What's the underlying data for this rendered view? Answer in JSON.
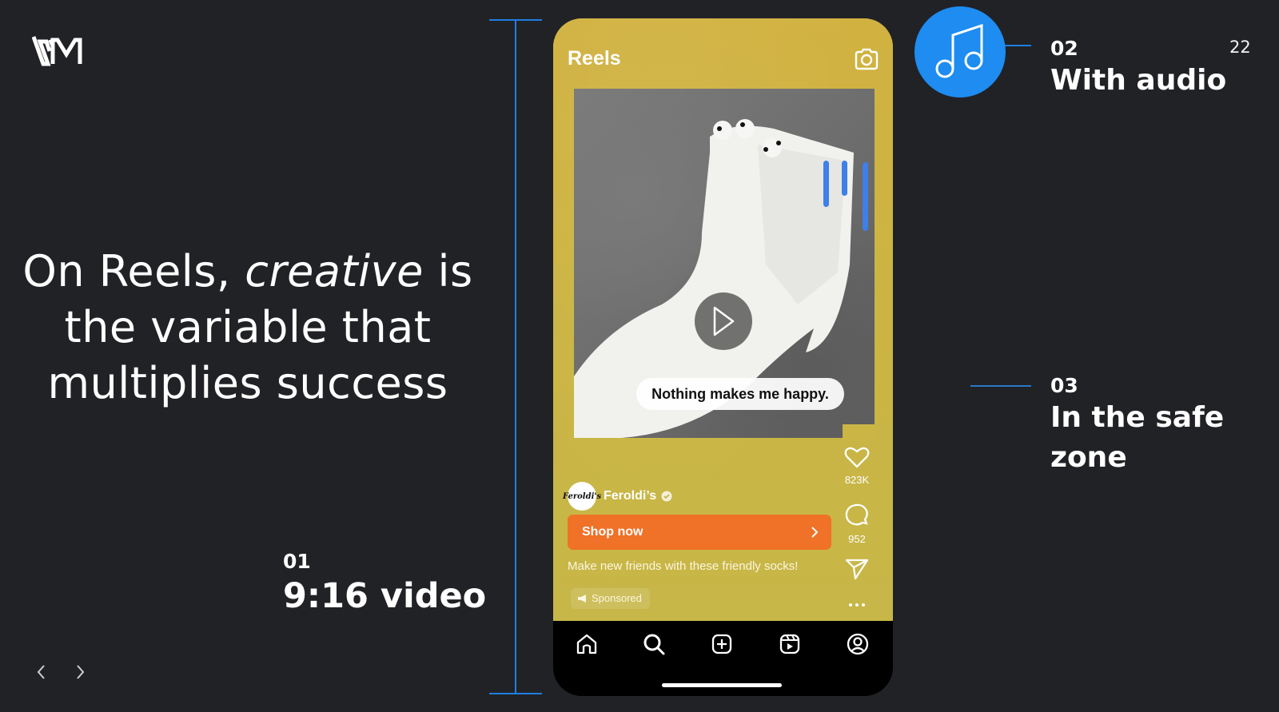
{
  "slide": {
    "logo_text": "VM",
    "page_number": "22",
    "headline": {
      "part1": "On Reels, ",
      "emphasis": "creative",
      "part2": " is the variable that multiplies success"
    },
    "callouts": [
      {
        "number": "01",
        "title": "9:16 video"
      },
      {
        "number": "02",
        "title": "With audio"
      },
      {
        "number": "03",
        "title": "In the safe zone"
      }
    ],
    "nav": {
      "prev_icon": "chevron-left-icon",
      "next_icon": "chevron-right-icon"
    },
    "colors": {
      "background": "#212226",
      "accent_blue": "#1e8cf0",
      "phone_yellow": "#cfb344",
      "cta_orange": "#f07128"
    }
  },
  "phone": {
    "header_title": "Reels",
    "camera_icon": "camera-icon",
    "video_caption": "Nothing makes me happy.",
    "play_icon": "play-icon",
    "actions": [
      {
        "icon": "heart-icon",
        "count": "823K"
      },
      {
        "icon": "comment-icon",
        "count": "952"
      },
      {
        "icon": "send-icon",
        "count": ""
      },
      {
        "icon": "more-icon",
        "count": ""
      }
    ],
    "profile": {
      "avatar_text": "Feroldi's",
      "name": "Feroldi’s",
      "verified": true
    },
    "cta_label": "Shop now",
    "ad_caption": "Make new friends with these friendly socks!",
    "sponsored_label": "Sponsored",
    "tab_bar": [
      "home-icon",
      "search-icon",
      "create-icon",
      "reels-icon",
      "profile-icon"
    ]
  }
}
